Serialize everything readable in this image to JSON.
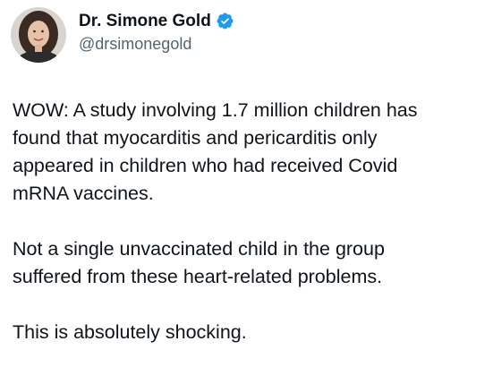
{
  "author": {
    "display_name": "Dr. Simone Gold",
    "handle": "@drsimonegold",
    "verified_icon": "verified-badge-icon",
    "badge_color": "#1d9bf0",
    "avatar_icon": "profile-avatar"
  },
  "tweet": {
    "paragraphs": [
      "WOW: A study involving 1.7 million children has\nfound that myocarditis and pericarditis only\nappeared in children who had received Covid\nmRNA vaccines.",
      "Not a single unvaccinated child in the group\nsuffered from these heart-related problems.",
      "This is absolutely shocking."
    ]
  }
}
